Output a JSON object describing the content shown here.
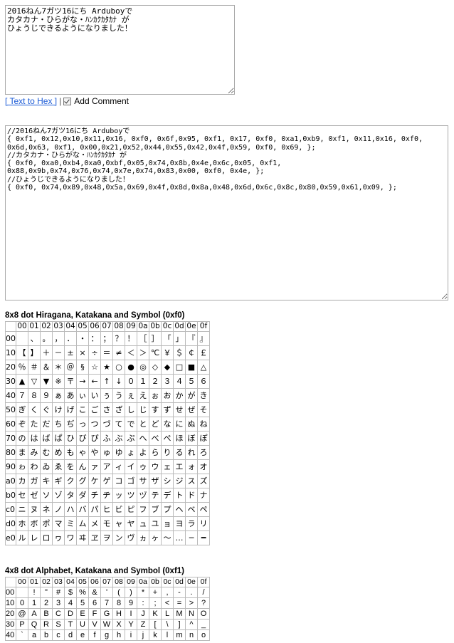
{
  "input": {
    "text": "2016ねん7ガツ16にち Arduboyで\nカタカナ・ひらがな・ﾊﾝｶｸｶﾀｶﾅ が\nひょうじできるようになりました！"
  },
  "controls": {
    "convert_link": "[ Text to Hex ]",
    "separator": "|",
    "add_comment_label": "Add Comment",
    "add_comment_checked": true
  },
  "output": {
    "text": "//2016ねん7ガツ16にち Arduboyで\n{ 0xf1, 0x12,0x10,0x11,0x16, 0xf0, 0x6f,0x95, 0xf1, 0x17, 0xf0, 0xa1,0xb9, 0xf1, 0x11,0x16, 0xf0,\n0x6d,0x63, 0xf1, 0x00,0x21,0x52,0x44,0x55,0x42,0x4f,0x59, 0xf0, 0x69, };\n//カタカナ・ひらがな・ﾊﾝｶｸｶﾀｶﾅ が\n{ 0xf0, 0xa0,0xb4,0xa0,0xbf,0x05,0x74,0x8b,0x4e,0x6c,0x05, 0xf1,\n0x88,0x9b,0x74,0x76,0x74,0x7e,0x74,0x83,0x00, 0xf0, 0x4e, };\n//ひょうじできるようになりました！\n{ 0xf0, 0x74,0x89,0x48,0x5a,0x69,0x4f,0x8d,0x8a,0x48,0x6d,0x6c,0x8c,0x80,0x59,0x61,0x09, };"
  },
  "hiragana_table": {
    "title": "8x8 dot Hiragana, Katakana and Symbol (0xf0)",
    "header": [
      "00",
      "01",
      "02",
      "03",
      "04",
      "05",
      "06",
      "07",
      "08",
      "09",
      "0a",
      "0b",
      "0c",
      "0d",
      "0e",
      "0f"
    ],
    "rows": [
      {
        "label": "00",
        "cells": [
          "",
          "、",
          "。",
          "，",
          "．",
          "・",
          "：",
          "；",
          "？",
          "！",
          "［",
          "］",
          "「",
          "」",
          "『",
          "』"
        ]
      },
      {
        "label": "10",
        "cells": [
          "【",
          "】",
          "＋",
          "－",
          "±",
          "×",
          "÷",
          "＝",
          "≠",
          "＜",
          "＞",
          "℃",
          "￥",
          "＄",
          "￠",
          "￡"
        ]
      },
      {
        "label": "20",
        "cells": [
          "％",
          "＃",
          "＆",
          "＊",
          "＠",
          "§",
          "☆",
          "★",
          "○",
          "●",
          "◎",
          "◇",
          "◆",
          "□",
          "■",
          "△"
        ]
      },
      {
        "label": "30",
        "cells": [
          "▲",
          "▽",
          "▼",
          "※",
          "〒",
          "→",
          "←",
          "↑",
          "↓",
          "０",
          "１",
          "２",
          "３",
          "４",
          "５",
          "６"
        ]
      },
      {
        "label": "40",
        "cells": [
          "７",
          "８",
          "９",
          "ぁ",
          "あ",
          "ぃ",
          "い",
          "ぅ",
          "う",
          "ぇ",
          "え",
          "ぉ",
          "お",
          "か",
          "が",
          "き"
        ]
      },
      {
        "label": "50",
        "cells": [
          "ぎ",
          "く",
          "ぐ",
          "け",
          "げ",
          "こ",
          "ご",
          "さ",
          "ざ",
          "し",
          "じ",
          "す",
          "ず",
          "せ",
          "ぜ",
          "そ"
        ]
      },
      {
        "label": "60",
        "cells": [
          "ぞ",
          "た",
          "だ",
          "ち",
          "ぢ",
          "っ",
          "つ",
          "づ",
          "て",
          "で",
          "と",
          "ど",
          "な",
          "に",
          "ぬ",
          "ね"
        ]
      },
      {
        "label": "70",
        "cells": [
          "の",
          "は",
          "ば",
          "ぱ",
          "ひ",
          "び",
          "ぴ",
          "ふ",
          "ぶ",
          "ぷ",
          "へ",
          "べ",
          "ぺ",
          "ほ",
          "ぼ",
          "ぽ"
        ]
      },
      {
        "label": "80",
        "cells": [
          "ま",
          "み",
          "む",
          "め",
          "も",
          "ゃ",
          "や",
          "ゅ",
          "ゆ",
          "ょ",
          "よ",
          "ら",
          "り",
          "る",
          "れ",
          "ろ"
        ]
      },
      {
        "label": "90",
        "cells": [
          "ゎ",
          "わ",
          "ゐ",
          "ゑ",
          "を",
          "ん",
          "ァ",
          "ア",
          "ィ",
          "イ",
          "ゥ",
          "ウ",
          "ェ",
          "エ",
          "ォ",
          "オ"
        ]
      },
      {
        "label": "a0",
        "cells": [
          "カ",
          "ガ",
          "キ",
          "ギ",
          "ク",
          "グ",
          "ケ",
          "ゲ",
          "コ",
          "ゴ",
          "サ",
          "ザ",
          "シ",
          "ジ",
          "ス",
          "ズ"
        ]
      },
      {
        "label": "b0",
        "cells": [
          "セ",
          "ゼ",
          "ソ",
          "ゾ",
          "タ",
          "ダ",
          "チ",
          "ヂ",
          "ッ",
          "ツ",
          "ヅ",
          "テ",
          "デ",
          "ト",
          "ド",
          "ナ"
        ]
      },
      {
        "label": "c0",
        "cells": [
          "ニ",
          "ヌ",
          "ネ",
          "ノ",
          "ハ",
          "バ",
          "パ",
          "ヒ",
          "ビ",
          "ピ",
          "フ",
          "ブ",
          "プ",
          "ヘ",
          "ベ",
          "ペ"
        ]
      },
      {
        "label": "d0",
        "cells": [
          "ホ",
          "ボ",
          "ポ",
          "マ",
          "ミ",
          "ム",
          "メ",
          "モ",
          "ャ",
          "ヤ",
          "ュ",
          "ユ",
          "ョ",
          "ヨ",
          "ラ",
          "リ"
        ]
      },
      {
        "label": "e0",
        "cells": [
          "ル",
          "レ",
          "ロ",
          "ヮ",
          "ワ",
          "ヰ",
          "ヱ",
          "ヲ",
          "ン",
          "ヴ",
          "ヵ",
          "ヶ",
          "〜",
          "…",
          "─",
          "━"
        ]
      }
    ]
  },
  "alphabet_table": {
    "title": "4x8 dot Alphabet, Katakana and Symbol (0xf1)",
    "header": [
      "00",
      "01",
      "02",
      "03",
      "04",
      "05",
      "06",
      "07",
      "08",
      "09",
      "0a",
      "0b",
      "0c",
      "0d",
      "0e",
      "0f"
    ],
    "rows": [
      {
        "label": "00",
        "cells": [
          "",
          "!",
          "\"",
          "#",
          "$",
          "%",
          "&",
          "'",
          "(",
          ")",
          "*",
          "+",
          ",",
          "-",
          ".",
          "/"
        ]
      },
      {
        "label": "10",
        "cells": [
          "0",
          "1",
          "2",
          "3",
          "4",
          "5",
          "6",
          "7",
          "8",
          "9",
          ":",
          ";",
          "<",
          "=",
          ">",
          "?"
        ]
      },
      {
        "label": "20",
        "cells": [
          "@",
          "A",
          "B",
          "C",
          "D",
          "E",
          "F",
          "G",
          "H",
          "I",
          "J",
          "K",
          "L",
          "M",
          "N",
          "O"
        ]
      },
      {
        "label": "30",
        "cells": [
          "P",
          "Q",
          "R",
          "S",
          "T",
          "U",
          "V",
          "W",
          "X",
          "Y",
          "Z",
          "[",
          "\\",
          "]",
          "^",
          "_"
        ]
      },
      {
        "label": "40",
        "cells": [
          "`",
          "a",
          "b",
          "c",
          "d",
          "e",
          "f",
          "g",
          "h",
          "i",
          "j",
          "k",
          "l",
          "m",
          "n",
          "o"
        ]
      }
    ]
  }
}
